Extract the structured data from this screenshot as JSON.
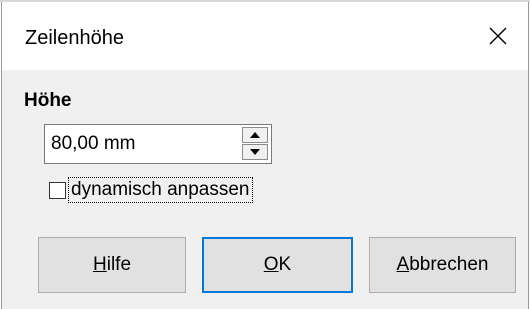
{
  "dialog": {
    "title": "Zeilenhöhe",
    "close_icon": "close-icon"
  },
  "height_section": {
    "label": "Höhe",
    "value": "80,00 mm",
    "spin_up_icon": "triangle-up-icon",
    "spin_down_icon": "triangle-down-icon"
  },
  "auto_fit": {
    "label": "dynamisch anpassen",
    "checked": false
  },
  "buttons": {
    "help": {
      "mnemonic": "H",
      "rest": "ilfe"
    },
    "ok": {
      "mnemonic": "O",
      "rest": "K"
    },
    "cancel": {
      "mnemonic": "A",
      "rest": "bbrechen"
    }
  },
  "colors": {
    "dialog_bg": "#f0f0f0",
    "titlebar_bg": "#ffffff",
    "button_bg": "#e1e1e1",
    "default_button_border": "#0078d7"
  }
}
